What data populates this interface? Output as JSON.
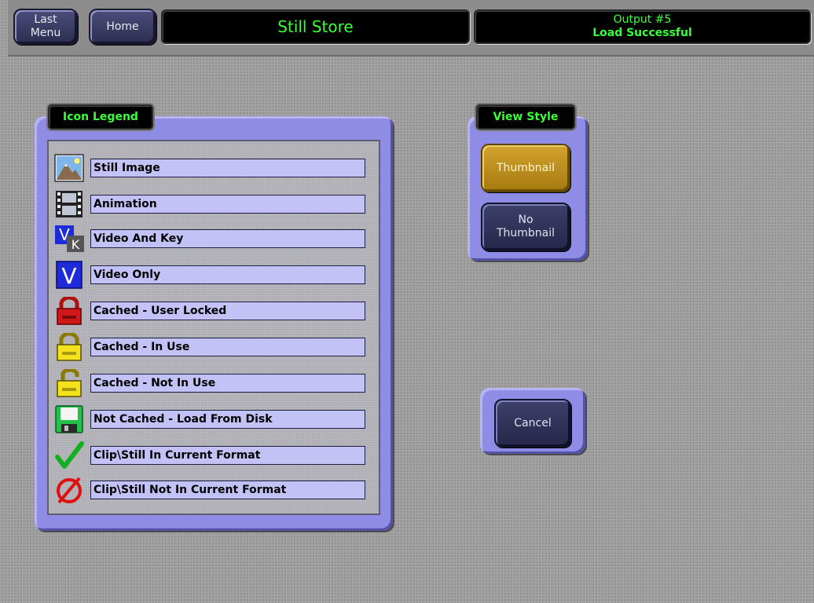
{
  "header": {
    "last_menu_label": "Last\nMenu",
    "last_menu_line1": "Last",
    "last_menu_line2": "Menu",
    "home_label": "Home",
    "title": "Still Store",
    "status_line1": "Output #5",
    "status_line2": "Load Successful"
  },
  "legend": {
    "title": "Icon Legend",
    "items": [
      {
        "icon": "still-image-icon",
        "label": "Still Image"
      },
      {
        "icon": "animation-icon",
        "label": "Animation"
      },
      {
        "icon": "video-and-key-icon",
        "label": "Video And Key"
      },
      {
        "icon": "video-only-icon",
        "label": "Video Only"
      },
      {
        "icon": "red-lock-icon",
        "label": "Cached - User Locked"
      },
      {
        "icon": "yellow-lock-icon",
        "label": "Cached - In Use"
      },
      {
        "icon": "open-lock-icon",
        "label": "Cached - Not In Use"
      },
      {
        "icon": "floppy-disk-icon",
        "label": "Not Cached - Load From Disk"
      },
      {
        "icon": "green-check-icon",
        "label": "Clip\\Still In Current Format"
      },
      {
        "icon": "red-slash-circle-icon",
        "label": "Clip\\Still Not In Current Format"
      }
    ],
    "vk_letter_v": "V",
    "vk_letter_k": "K",
    "v_letter": "V"
  },
  "view_style": {
    "title": "View Style",
    "thumbnail_label": "Thumbnail",
    "no_thumbnail_line1": "No",
    "no_thumbnail_line2": "Thumbnail",
    "selected": "Thumbnail"
  },
  "cancel_label": "Cancel",
  "colors": {
    "status_text": "#39ff39",
    "panel": "#8f8ce6",
    "selected_button": "#c8961d",
    "label_field": "#c2c2f7"
  }
}
